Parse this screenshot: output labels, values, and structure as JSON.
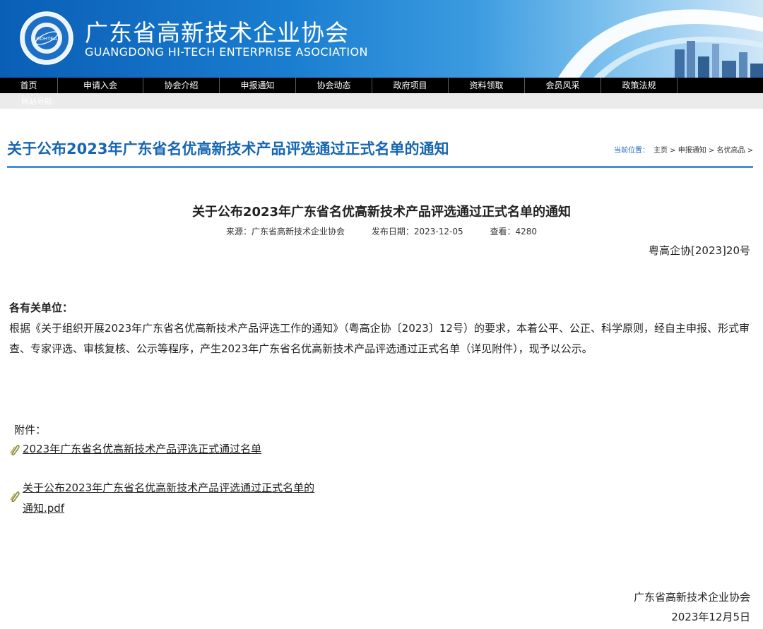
{
  "header": {
    "title_cn": "广东省高新技术企业协会",
    "title_en": "GUANGDONG HI-TECH ENTERPRISE ASOCIATION",
    "logo_text": "GDHTEA"
  },
  "nav": {
    "items": [
      "首页",
      "申请入会",
      "协会介绍",
      "申报通知",
      "协会动态",
      "政府项目",
      "资料领取",
      "会员风采",
      "政策法规"
    ]
  },
  "strip": {
    "text": "网站导航"
  },
  "page": {
    "title": "关于公布2023年广东省名优高新技术产品评选通过正式名单的通知",
    "breadcrumb_label": "当前位置：",
    "breadcrumb_path": "主页 > 申报通知 > 名优高品 >"
  },
  "article": {
    "title": "关于公布2023年广东省名优高新技术产品评选通过正式名单的通知",
    "source": "来源：广东省高新技术企业协会",
    "date": "发布日期：2023-12-05",
    "views": "查看：4280",
    "doc_number": "粤高企协[2023]20号",
    "greeting": "各有关单位：",
    "body": "根据《关于组织开展2023年广东省名优高新技术产品评选工作的通知》（粤高企协〔2023〕12号）的要求，本着公平、公正、科学原则，经自主申报、形式审查、专家评选、审核复核、公示等程序，产生2023年广东省名优高新技术产品评选通过正式名单（详见附件），现予以公示。",
    "attachments_label": "附件：",
    "attachments": [
      "2023年广东省名优高新技术产品评选正式通过名单",
      "关于公布2023年广东省名优高新技术产品评选通过正式名单的通知.pdf"
    ],
    "signature": "广东省高新技术企业协会",
    "sign_date": "2023年12月5日"
  }
}
